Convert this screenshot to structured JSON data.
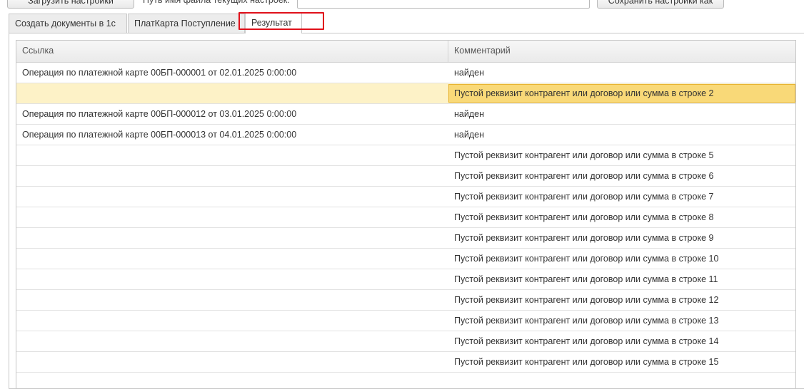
{
  "toolbar": {
    "load_label": "Загрузить настройки",
    "path_label": "Путь имя файла текущих настроек:",
    "path_value": "",
    "save_label": "Сохранить настройки как"
  },
  "tabs": [
    {
      "label": "Создать документы в 1с"
    },
    {
      "label": "ПлатКарта Поступление"
    },
    {
      "label": "Результат"
    }
  ],
  "table": {
    "columns": [
      "Ссылка",
      "Комментарий"
    ],
    "rows": [
      {
        "link": "Операция по платежной карте 00БП-000001 от 02.01.2025 0:00:00",
        "comment": "найден"
      },
      {
        "link": "",
        "comment": "Пустой реквизит контрагент или договор или сумма в строке 2"
      },
      {
        "link": "Операция по платежной карте 00БП-000012 от 03.01.2025 0:00:00",
        "comment": "найден"
      },
      {
        "link": "Операция по платежной карте 00БП-000013 от 04.01.2025 0:00:00",
        "comment": "найден"
      },
      {
        "link": "",
        "comment": "Пустой реквизит контрагент или договор или сумма в строке 5"
      },
      {
        "link": "",
        "comment": "Пустой реквизит контрагент или договор или сумма в строке 6"
      },
      {
        "link": "",
        "comment": "Пустой реквизит контрагент или договор или сумма в строке 7"
      },
      {
        "link": "",
        "comment": "Пустой реквизит контрагент или договор или сумма в строке 8"
      },
      {
        "link": "",
        "comment": "Пустой реквизит контрагент или договор или сумма в строке 9"
      },
      {
        "link": "",
        "comment": "Пустой реквизит контрагент или договор или сумма в строке 10"
      },
      {
        "link": "",
        "comment": "Пустой реквизит контрагент или договор или сумма в строке 11"
      },
      {
        "link": "",
        "comment": "Пустой реквизит контрагент или договор или сумма в строке 12"
      },
      {
        "link": "",
        "comment": "Пустой реквизит контрагент или договор или сумма в строке 13"
      },
      {
        "link": "",
        "comment": "Пустой реквизит контрагент или договор или сумма в строке 14"
      },
      {
        "link": "",
        "comment": "Пустой реквизит контрагент или договор или сумма в строке 15"
      },
      {
        "link": "",
        "comment": ""
      }
    ]
  },
  "colors": {
    "highlight": "#e0101a",
    "selected_row": "#fdf2c7",
    "selected_cell": "#f9d978"
  }
}
